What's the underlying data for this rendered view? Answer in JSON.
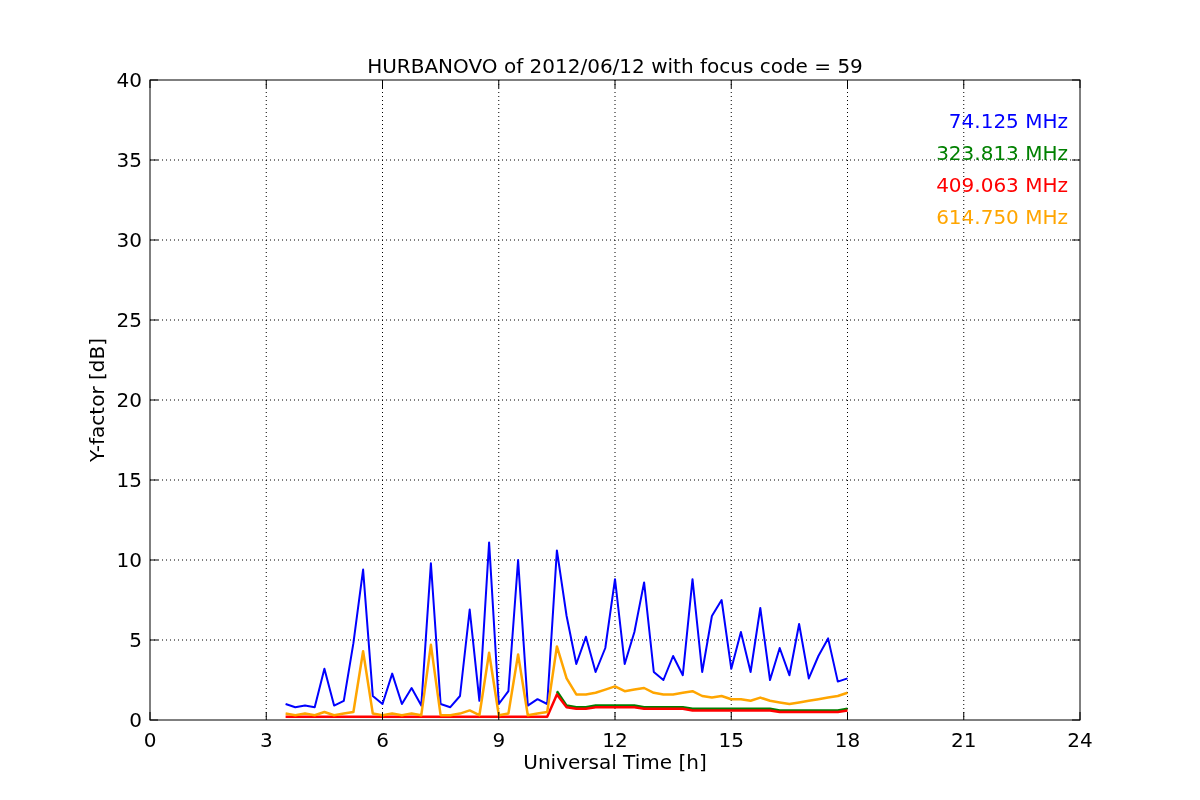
{
  "chart_data": {
    "type": "line",
    "title": "HURBANOVO of 2012/06/12 with focus code = 59",
    "xlabel": "Universal Time [h]",
    "ylabel": "Y-factor [dB]",
    "xlim": [
      0,
      24
    ],
    "ylim": [
      0,
      40
    ],
    "xticks": [
      0,
      3,
      6,
      9,
      12,
      15,
      18,
      21,
      24
    ],
    "yticks": [
      0,
      5,
      10,
      15,
      20,
      25,
      30,
      35,
      40
    ],
    "grid": true,
    "x": [
      3.5,
      3.75,
      4,
      4.25,
      4.5,
      4.75,
      5,
      5.25,
      5.5,
      5.75,
      6,
      6.25,
      6.5,
      6.75,
      7,
      7.25,
      7.5,
      7.75,
      8,
      8.25,
      8.5,
      8.75,
      9,
      9.25,
      9.5,
      9.75,
      10,
      10.25,
      10.5,
      10.75,
      11,
      11.25,
      11.5,
      11.75,
      12,
      12.25,
      12.5,
      12.75,
      13,
      13.25,
      13.5,
      13.75,
      14,
      14.25,
      14.5,
      14.75,
      15,
      15.25,
      15.5,
      15.75,
      16,
      16.25,
      16.5,
      16.75,
      17,
      17.25,
      17.5,
      17.75,
      18
    ],
    "series": [
      {
        "name": "74.125 MHz",
        "color": "#0000ff",
        "values": [
          1.0,
          0.8,
          0.9,
          0.8,
          3.2,
          0.9,
          1.2,
          4.8,
          9.4,
          1.5,
          1.0,
          2.9,
          1.0,
          2.0,
          0.9,
          9.8,
          1.0,
          0.8,
          1.5,
          6.9,
          1.2,
          11.1,
          1.0,
          1.8,
          10.0,
          0.9,
          1.3,
          1.0,
          10.6,
          6.5,
          3.5,
          5.2,
          3.0,
          4.5,
          8.8,
          3.5,
          5.5,
          8.6,
          3.0,
          2.5,
          4.0,
          2.8,
          8.8,
          3.0,
          6.5,
          7.5,
          3.2,
          5.5,
          3.0,
          7.0,
          2.5,
          4.5,
          2.8,
          6.0,
          2.6,
          4.0,
          5.1,
          2.4,
          2.6
        ]
      },
      {
        "name": "323.813 MHz",
        "color": "#008000",
        "values": [
          null,
          null,
          null,
          null,
          null,
          null,
          null,
          null,
          null,
          null,
          null,
          null,
          null,
          null,
          null,
          null,
          null,
          null,
          null,
          null,
          null,
          null,
          null,
          null,
          null,
          null,
          null,
          null,
          1.8,
          0.9,
          0.8,
          0.8,
          0.9,
          0.9,
          0.9,
          0.9,
          0.9,
          0.8,
          0.8,
          0.8,
          0.8,
          0.8,
          0.7,
          0.7,
          0.7,
          0.7,
          0.7,
          0.7,
          0.7,
          0.7,
          0.7,
          0.6,
          0.6,
          0.6,
          0.6,
          0.6,
          0.6,
          0.6,
          0.7
        ]
      },
      {
        "name": "409.063 MHz",
        "color": "#ff0000",
        "values": [
          0.2,
          0.2,
          0.2,
          0.2,
          0.2,
          0.2,
          0.2,
          0.2,
          0.2,
          0.2,
          0.2,
          0.2,
          0.2,
          0.2,
          0.2,
          0.2,
          0.2,
          0.2,
          0.2,
          0.2,
          0.2,
          0.2,
          0.2,
          0.2,
          0.2,
          0.2,
          0.2,
          0.2,
          1.6,
          0.8,
          0.7,
          0.7,
          0.8,
          0.8,
          0.8,
          0.8,
          0.8,
          0.7,
          0.7,
          0.7,
          0.7,
          0.7,
          0.6,
          0.6,
          0.6,
          0.6,
          0.6,
          0.6,
          0.6,
          0.6,
          0.6,
          0.5,
          0.5,
          0.5,
          0.5,
          0.5,
          0.5,
          0.5,
          0.6
        ]
      },
      {
        "name": "614.750 MHz",
        "color": "#ffa500",
        "values": [
          0.4,
          0.3,
          0.4,
          0.3,
          0.5,
          0.3,
          0.4,
          0.5,
          4.3,
          0.4,
          0.3,
          0.4,
          0.3,
          0.4,
          0.3,
          4.7,
          0.3,
          0.3,
          0.4,
          0.6,
          0.3,
          4.2,
          0.3,
          0.4,
          4.1,
          0.3,
          0.4,
          0.5,
          4.6,
          2.6,
          1.6,
          1.6,
          1.7,
          1.9,
          2.1,
          1.8,
          1.9,
          2.0,
          1.7,
          1.6,
          1.6,
          1.7,
          1.8,
          1.5,
          1.4,
          1.5,
          1.3,
          1.3,
          1.2,
          1.4,
          1.2,
          1.1,
          1.0,
          1.1,
          1.2,
          1.3,
          1.4,
          1.5,
          1.7
        ]
      }
    ]
  }
}
